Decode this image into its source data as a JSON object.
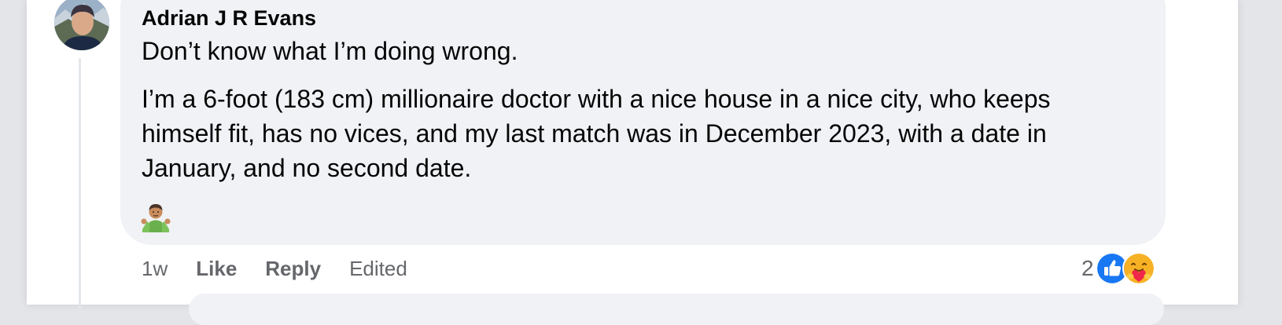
{
  "comment": {
    "author": "Adrian J R Evans",
    "paragraphs": [
      "Don’t know what I’m doing wrong.",
      "I’m a 6-foot (183 cm) millionaire doctor with a nice house in a nice city, who keeps himself fit, has no vices, and my last match was in December 2023, with a date in January, and no second date."
    ],
    "emoji": "person-shrugging-emoji",
    "timestamp": "1w",
    "like_label": "Like",
    "reply_label": "Reply",
    "edited_label": "Edited",
    "reactions": {
      "count": "2",
      "icons": [
        "like-reaction-icon",
        "care-reaction-icon"
      ]
    }
  },
  "colors": {
    "bubble": "#f0f2f5",
    "text": "#050505",
    "secondary_text": "#65676b",
    "like_blue": "#1877f2",
    "care_yellow": "#f7b125"
  }
}
